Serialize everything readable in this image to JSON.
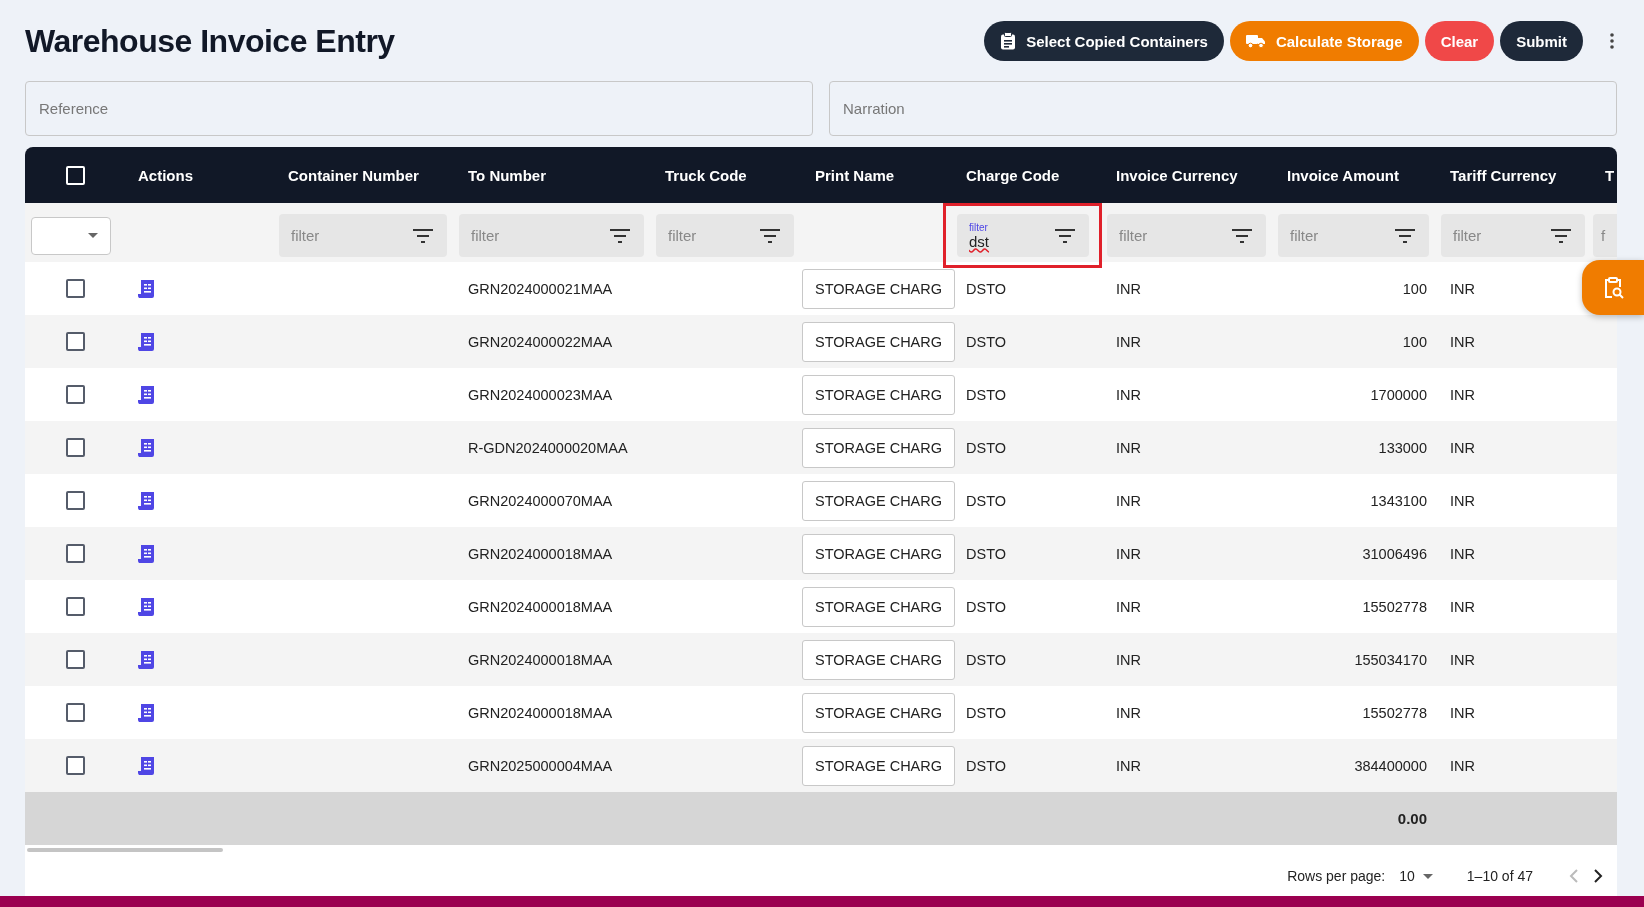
{
  "title": "Warehouse Invoice Entry",
  "actions": [
    {
      "label": "Select Copied Containers",
      "kind": "dark"
    },
    {
      "label": "Calculate Storage",
      "kind": "orange"
    },
    {
      "label": "Clear",
      "kind": "red"
    },
    {
      "label": "Submit",
      "kind": "dark"
    }
  ],
  "fields": [
    {
      "placeholder": "Reference"
    },
    {
      "placeholder": "Narration"
    }
  ],
  "table": {
    "select_all_checked": false,
    "columns": [
      {
        "label": "Actions"
      },
      {
        "label": "Container Number",
        "filter": {
          "placeholder": "filter"
        }
      },
      {
        "label": "To Number",
        "filter": {
          "placeholder": "filter"
        }
      },
      {
        "label": "Truck Code",
        "filter": {
          "placeholder": "filter"
        }
      },
      {
        "label": "Print Name"
      },
      {
        "label": "Charge Code",
        "filter": {
          "label": "filter",
          "value": "dst",
          "highlighted": true
        }
      },
      {
        "label": "Invoice Currency",
        "filter": {
          "placeholder": "filter"
        }
      },
      {
        "label": "Invoice Amount",
        "filter": {
          "placeholder": "filter"
        }
      },
      {
        "label": "Tariff Currency",
        "filter": {
          "placeholder": "filter"
        }
      },
      {
        "label": "T",
        "filter": {
          "placeholder": "f"
        }
      }
    ],
    "rows": [
      {
        "checked": false,
        "to_number": "GRN2024000021MAA",
        "print_name": "STORAGE CHARG",
        "charge_code": "DSTO",
        "invoice_currency": "INR",
        "invoice_amount": "100",
        "tariff_currency": "INR"
      },
      {
        "checked": false,
        "to_number": "GRN2024000022MAA",
        "print_name": "STORAGE CHARG",
        "charge_code": "DSTO",
        "invoice_currency": "INR",
        "invoice_amount": "100",
        "tariff_currency": "INR"
      },
      {
        "checked": false,
        "to_number": "GRN2024000023MAA",
        "print_name": "STORAGE CHARG",
        "charge_code": "DSTO",
        "invoice_currency": "INR",
        "invoice_amount": "1700000",
        "tariff_currency": "INR"
      },
      {
        "checked": false,
        "to_number": "R-GDN2024000020MAA",
        "print_name": "STORAGE CHARG",
        "charge_code": "DSTO",
        "invoice_currency": "INR",
        "invoice_amount": "133000",
        "tariff_currency": "INR"
      },
      {
        "checked": false,
        "to_number": "GRN2024000070MAA",
        "print_name": "STORAGE CHARG",
        "charge_code": "DSTO",
        "invoice_currency": "INR",
        "invoice_amount": "1343100",
        "tariff_currency": "INR"
      },
      {
        "checked": false,
        "to_number": "GRN2024000018MAA",
        "print_name": "STORAGE CHARG",
        "charge_code": "DSTO",
        "invoice_currency": "INR",
        "invoice_amount": "31006496",
        "tariff_currency": "INR"
      },
      {
        "checked": false,
        "to_number": "GRN2024000018MAA",
        "print_name": "STORAGE CHARG",
        "charge_code": "DSTO",
        "invoice_currency": "INR",
        "invoice_amount": "15502778",
        "tariff_currency": "INR"
      },
      {
        "checked": false,
        "to_number": "GRN2024000018MAA",
        "print_name": "STORAGE CHARG",
        "charge_code": "DSTO",
        "invoice_currency": "INR",
        "invoice_amount": "155034170",
        "tariff_currency": "INR"
      },
      {
        "checked": false,
        "to_number": "GRN2024000018MAA",
        "print_name": "STORAGE CHARG",
        "charge_code": "DSTO",
        "invoice_currency": "INR",
        "invoice_amount": "15502778",
        "tariff_currency": "INR"
      },
      {
        "checked": false,
        "to_number": "GRN2025000004MAA",
        "print_name": "STORAGE CHARG",
        "charge_code": "DSTO",
        "invoice_currency": "INR",
        "invoice_amount": "384400000",
        "tariff_currency": "INR"
      }
    ],
    "total_amount": "0.00"
  },
  "pagination": {
    "rows_per_page_label": "Rows per page:",
    "rows_per_page": "10",
    "range": "1–10 of 47",
    "prev_disabled": true,
    "next_disabled": false
  }
}
